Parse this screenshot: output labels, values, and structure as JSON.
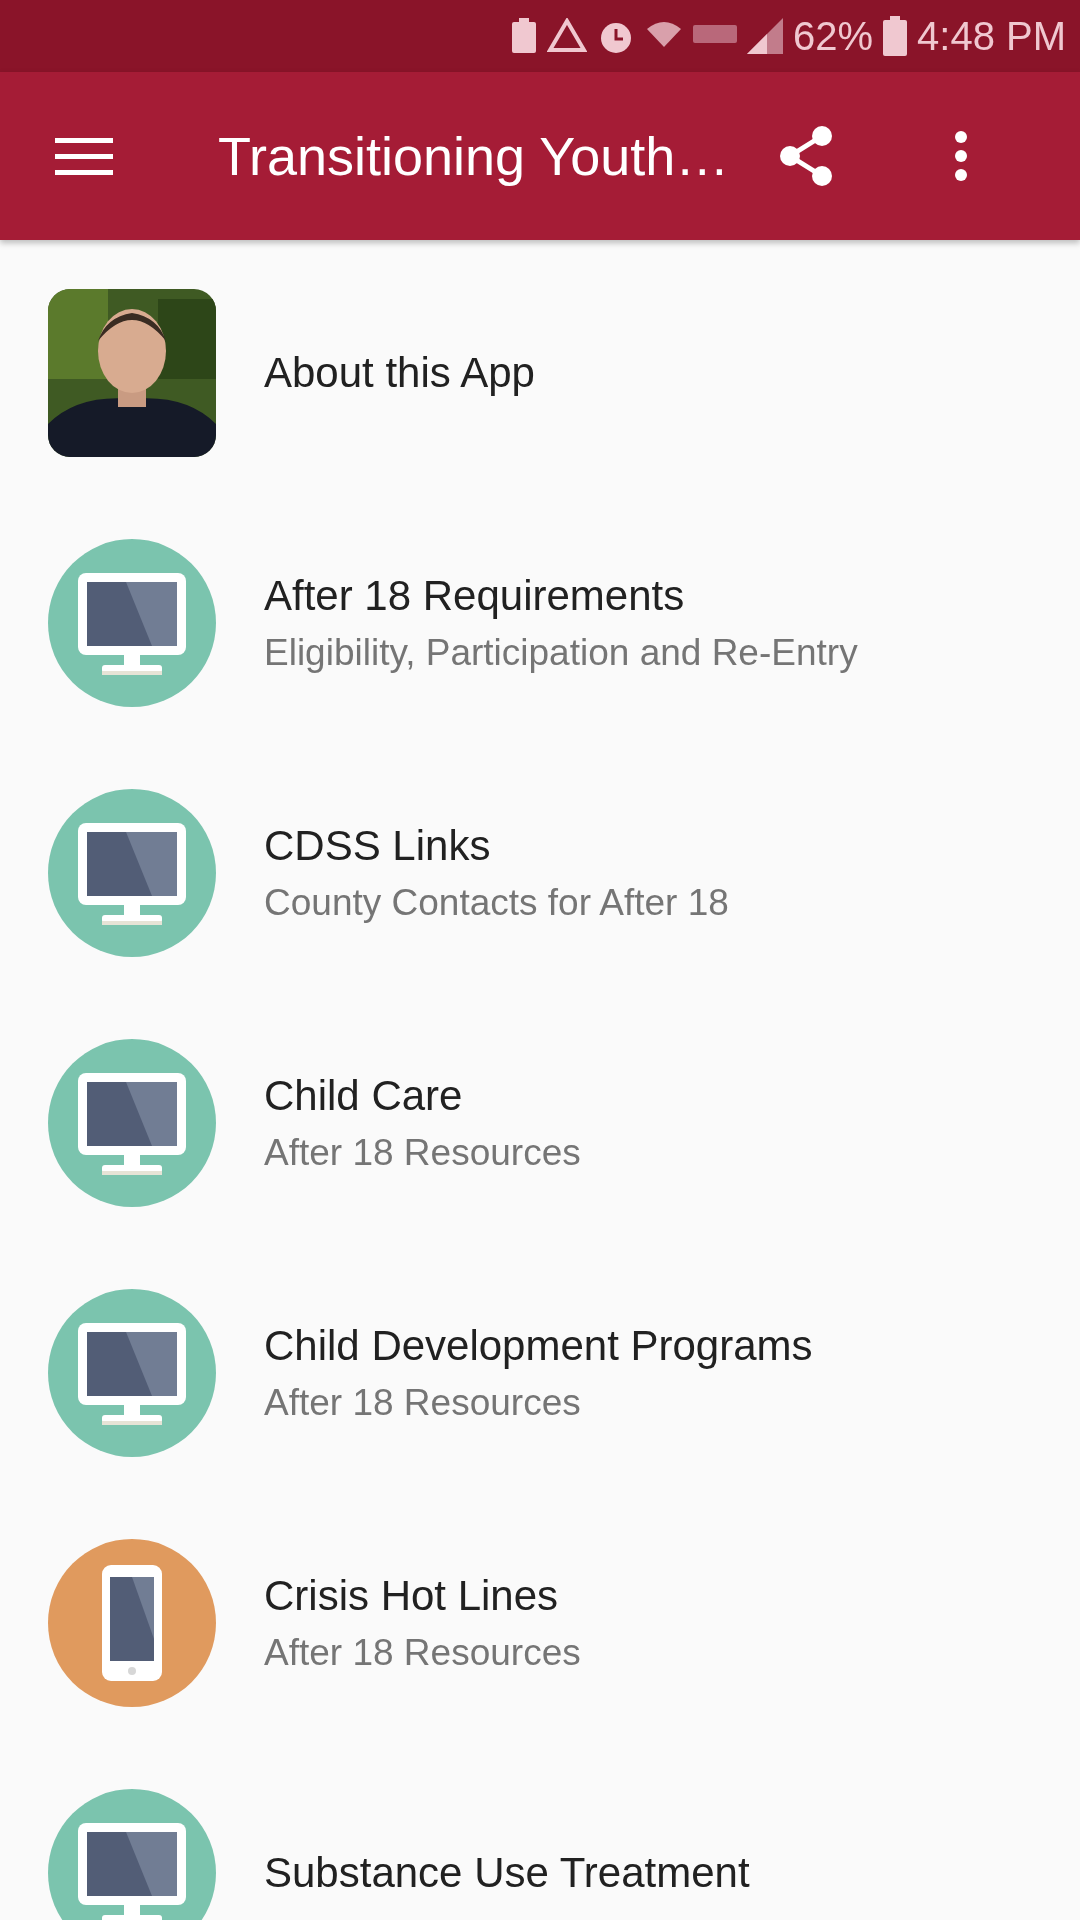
{
  "status_bar": {
    "battery_percent": "62%",
    "time": "4:48 PM"
  },
  "app_bar": {
    "title": "Transitioning Youth…"
  },
  "items": [
    {
      "kind": "picture",
      "title": "About this App"
    },
    {
      "kind": "monitor",
      "title": "After 18 Requirements",
      "subtitle": "Eligibility, Participation and Re-Entry"
    },
    {
      "kind": "monitor",
      "title": "CDSS Links",
      "subtitle": "County Contacts for After 18"
    },
    {
      "kind": "monitor",
      "title": "Child Care",
      "subtitle": "After 18 Resources"
    },
    {
      "kind": "monitor",
      "title": "Child Development Programs",
      "subtitle": "After 18 Resources"
    },
    {
      "kind": "phone",
      "title": "Crisis Hot Lines",
      "subtitle": "After 18 Resources"
    },
    {
      "kind": "monitor",
      "title": "Substance Use Treatment"
    }
  ]
}
